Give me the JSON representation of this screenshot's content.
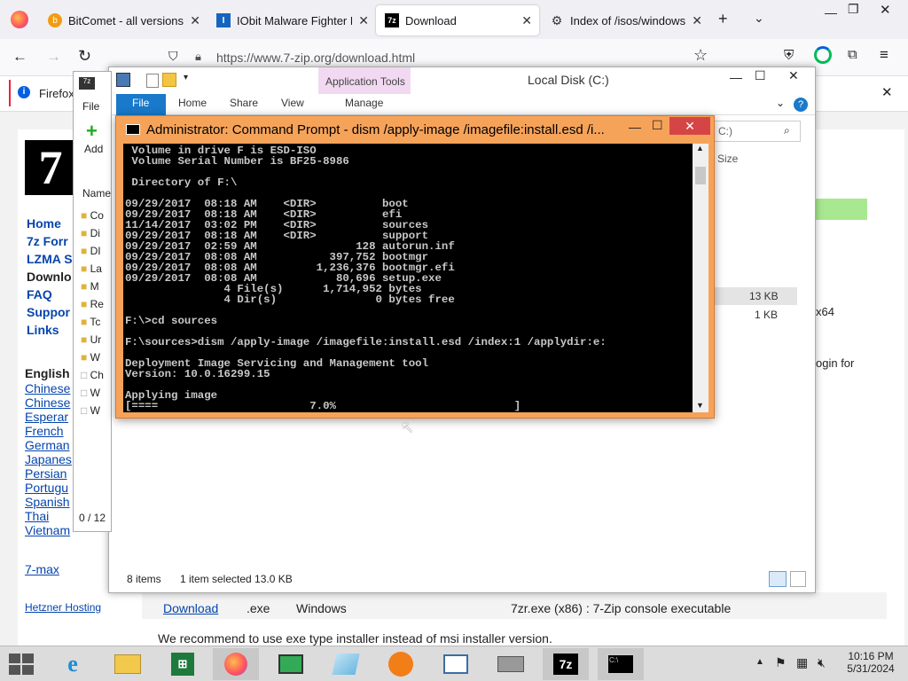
{
  "browser": {
    "tabs": [
      {
        "label": "BitComet - all versions a",
        "icon": "bitcomet-icon"
      },
      {
        "label": "IObit Malware Fighter Do",
        "icon": "iobit-icon"
      },
      {
        "label": "Download",
        "icon": "7zip-icon"
      },
      {
        "label": "Index of /isos/windows/",
        "icon": "web-icon"
      }
    ],
    "url": "https://www.7-zip.org/download.html",
    "notice": "Firefox"
  },
  "website": {
    "logo": "7",
    "nav": [
      "Home",
      "7z Forr",
      "LZMA S",
      "Downlo",
      "FAQ",
      "Suppor",
      "Links"
    ],
    "languages_heading": "English",
    "languages": [
      "Chinese",
      "Chinese",
      "Esperar",
      "French",
      "German",
      "Japanes",
      "Persian",
      "Portugu",
      "Spanish",
      "Thai",
      "Vietnam"
    ],
    "extra_link": "7-max",
    "hosting": "Hetzner Hosting",
    "row_download": "Download",
    "row_ext": ".exe",
    "row_os": "Windows",
    "row_desc": "7zr.exe (x86) : 7-Zip console executable",
    "right_x64": "x64",
    "right_login": "ogin for",
    "size1": "13 KB",
    "size2": "1 KB",
    "recommend": "We recommend to use exe type installer instead of msi installer version."
  },
  "explorer": {
    "title": "Local Disk (C:)",
    "context_tab": "Application Tools",
    "ribbon_tabs": [
      "File",
      "Home",
      "Share",
      "View",
      "Manage"
    ],
    "search_placeholder": "C:)",
    "column_name": "Name",
    "column_size": "Size",
    "items": [
      "Co",
      "Di",
      "DI",
      "La",
      "M",
      "Re",
      "Tc",
      "Ur",
      "W",
      "Ch",
      "W",
      "W"
    ],
    "status_items": "8 items",
    "status_selected": "1 item selected  13.0 KB",
    "left_status": "0 / 12",
    "add_label": "Add",
    "left_file_tab": "File"
  },
  "cmd": {
    "title": "Administrator: Command Prompt - dism  /apply-image /imagefile:install.esd /i...",
    "lines": [
      " Volume in drive F is ESD-ISO",
      " Volume Serial Number is BF25-8986",
      "",
      " Directory of F:\\",
      "",
      "09/29/2017  08:18 AM    <DIR>          boot",
      "09/29/2017  08:18 AM    <DIR>          efi",
      "11/14/2017  03:02 PM    <DIR>          sources",
      "09/29/2017  08:18 AM    <DIR>          support",
      "09/29/2017  02:59 AM               128 autorun.inf",
      "09/29/2017  08:08 AM           397,752 bootmgr",
      "09/29/2017  08:08 AM         1,236,376 bootmgr.efi",
      "09/29/2017  08:08 AM            80,696 setup.exe",
      "               4 File(s)      1,714,952 bytes",
      "               4 Dir(s)               0 bytes free",
      "",
      "F:\\>cd sources",
      "",
      "F:\\sources>dism /apply-image /imagefile:install.esd /index:1 /applydir:e:",
      "",
      "Deployment Image Servicing and Management tool",
      "Version: 10.0.16299.15",
      "",
      "Applying image",
      "[====                       7.0%                           ]"
    ],
    "progress_value": 0.07
  },
  "taskbar": {
    "time": "10:16 PM",
    "date": "5/31/2024",
    "apps": [
      "internet-explorer-icon",
      "file-explorer-icon",
      "excel-icon",
      "firefox-icon",
      "task-manager-icon",
      "notepad-icon",
      "avast-icon",
      "app-window-icon",
      "scanner-icon",
      "7zip-taskbar-icon",
      "cmd-taskbar-icon"
    ]
  },
  "colors": {
    "cmd_frame": "#f6a35a",
    "ribbon_file": "#1979ca",
    "link": "#0645ad"
  }
}
